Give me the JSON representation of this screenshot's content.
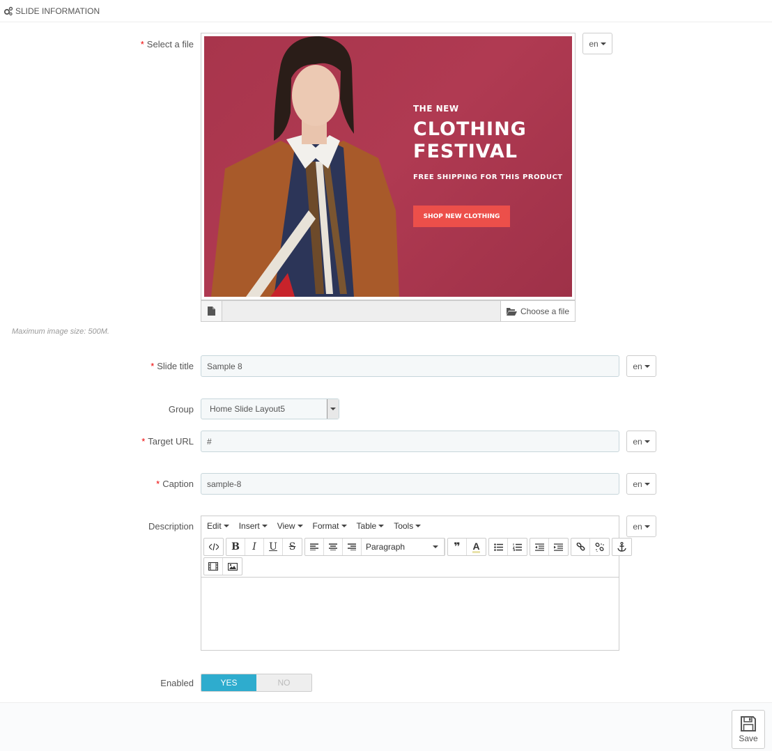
{
  "panel": {
    "title": "SLIDE INFORMATION"
  },
  "fields": {
    "file": {
      "label": "Select a file",
      "required": "*",
      "lang": "en",
      "choose_label": "Choose a file",
      "help": "Maximum image size: 500M."
    },
    "title": {
      "label": "Slide title",
      "required": "*",
      "value": "Sample 8",
      "lang": "en"
    },
    "group": {
      "label": "Group",
      "value": "Home Slide Layout5"
    },
    "url": {
      "label": "Target URL",
      "required": "*",
      "value": "#",
      "lang": "en"
    },
    "caption": {
      "label": "Caption",
      "required": "*",
      "value": "sample-8",
      "lang": "en"
    },
    "description": {
      "label": "Description",
      "lang": "en"
    },
    "enabled": {
      "label": "Enabled",
      "yes": "YES",
      "no": "NO",
      "value": "YES"
    }
  },
  "banner": {
    "line1": "THE NEW",
    "line2": "CLOTHING",
    "line3": "FESTIVAL",
    "line4": "FREE SHIPPING FOR THIS PRODUCT",
    "button": "SHOP NEW CLOTHING"
  },
  "editor": {
    "menus": [
      "Edit",
      "Insert",
      "View",
      "Format",
      "Table",
      "Tools"
    ],
    "block_format": "Paragraph"
  },
  "footer": {
    "save_label": "Save"
  },
  "colors": {
    "accent": "#2eacce",
    "required": "#ee0000",
    "banner_bg": "#a8354c",
    "banner_button": "#ec4f4a"
  }
}
